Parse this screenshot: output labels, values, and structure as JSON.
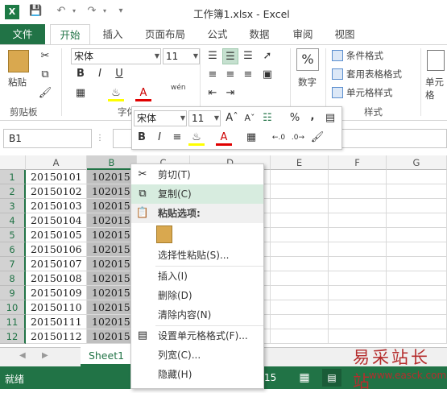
{
  "window": {
    "title": "工作簿1.xlsx - Excel"
  },
  "tabs": [
    "文件",
    "开始",
    "插入",
    "页面布局",
    "公式",
    "数据",
    "审阅",
    "视图"
  ],
  "ribbon": {
    "paste_label": "粘贴",
    "clipboard_group": "剪贴板",
    "font_group": "字体",
    "font_name": "宋体",
    "font_size": "11",
    "number_label": "数字",
    "number_symbol": "%",
    "conditional_format": "条件格式",
    "table_format": "套用表格格式",
    "cell_style": "单元格样式",
    "styles_group": "样式",
    "cells_label": "单元格",
    "wen_label": "wén"
  },
  "formula_bar": {
    "name_box": "B1"
  },
  "columns": [
    "A",
    "B",
    "C",
    "D",
    "E",
    "F",
    "G"
  ],
  "rows": [
    {
      "n": "1",
      "a": "20150101",
      "b": "1020150"
    },
    {
      "n": "2",
      "a": "20150102",
      "b": "1020150"
    },
    {
      "n": "3",
      "a": "20150103",
      "b": "1020150"
    },
    {
      "n": "4",
      "a": "20150104",
      "b": "1020150"
    },
    {
      "n": "5",
      "a": "20150105",
      "b": "1020150"
    },
    {
      "n": "6",
      "a": "20150106",
      "b": "1020150"
    },
    {
      "n": "7",
      "a": "20150107",
      "b": "1020150"
    },
    {
      "n": "8",
      "a": "20150108",
      "b": "1020150"
    },
    {
      "n": "9",
      "a": "20150109",
      "b": "1020150"
    },
    {
      "n": "10",
      "a": "20150110",
      "b": "1020150"
    },
    {
      "n": "11",
      "a": "20150111",
      "b": "1020150"
    },
    {
      "n": "12",
      "a": "20150112",
      "b": "1020150"
    }
  ],
  "mini_toolbar": {
    "font_name": "宋体",
    "font_size": "11",
    "percent": "%",
    "comma": ","
  },
  "context_menu": {
    "cut": "剪切(T)",
    "copy": "复制(C)",
    "paste_options": "粘贴选项:",
    "paste_special": "选择性粘贴(S)...",
    "insert": "插入(I)",
    "delete": "删除(D)",
    "clear": "清除内容(N)",
    "format_cells": "设置单元格格式(F)...",
    "column_width": "列宽(C)...",
    "hide": "隐藏(H)"
  },
  "sheet_tab": "Sheet1",
  "status": {
    "ready": "就绪",
    "count_fragment": "15"
  },
  "watermark": {
    "name": "易采站长站",
    "url": "www.easck.com"
  },
  "colors": {
    "excel_green": "#217346",
    "menu_highlight": "#d7ecdf",
    "selection_gray": "#bfbfbf"
  }
}
